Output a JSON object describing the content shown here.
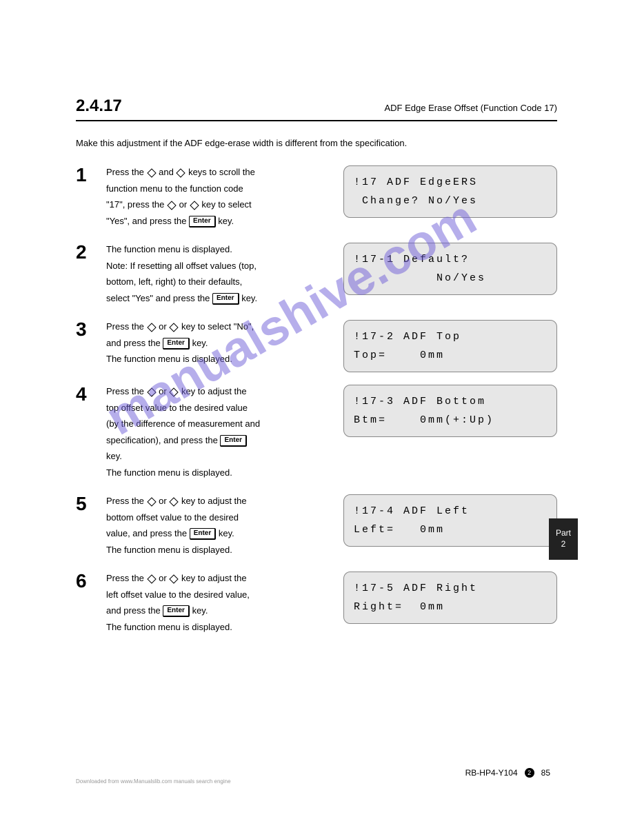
{
  "header": {
    "title": "2.4.17",
    "subtitle": "ADF Edge Erase Offset  (Function Code 17)"
  },
  "intro": "Make this adjustment if the ADF edge-erase width is different from the specification.",
  "watermark": "manualshive.com",
  "sidetab_line1": "Part",
  "sidetab_line2": "2",
  "steps": [
    {
      "num": "1",
      "text_lines": [
        "Press the <d> and <d> keys to scroll the",
        "function menu to the function code",
        "\"17\", press the <d> or <d> key to select",
        "\"Yes\", and press the <k>Enter</k> key."
      ],
      "lcd_lines": [
        "!17 ADF EdgeERS",
        " Change? No/Yes"
      ]
    },
    {
      "num": "2",
      "text_lines": [
        "The function menu is displayed.",
        "Note: If resetting all offset values (top,",
        "bottom, left, right) to their defaults,",
        "select \"Yes\" and press the <k>Enter</k> key."
      ],
      "lcd_lines": [
        "!17-1 Default?",
        "          No/Yes"
      ]
    },
    {
      "num": "3",
      "text_lines": [
        "Press the <d> or <d> key to select \"No\",",
        "and press the <k>Enter</k> key.",
        "The function menu is displayed."
      ],
      "lcd_lines": [
        "!17-2 ADF Top",
        "Top=    0mm"
      ]
    },
    {
      "num": "4",
      "text_lines": [
        "Press the <d> or <d> key to adjust the",
        "top offset value to the desired value",
        "(by the difference of measurement and",
        "specification), and press the <k>Enter</k>",
        "key.",
        "The function menu is displayed."
      ],
      "lcd_lines": [
        "!17-3 ADF Bottom",
        "Btm=    0mm(+:Up)"
      ]
    },
    {
      "num": "5",
      "text_lines": [
        "Press the <d> or <d> key to adjust the",
        "bottom offset value to the desired",
        "value, and press the <k>Enter</k> key.",
        "The function menu is displayed."
      ],
      "lcd_lines": [
        "!17-4 ADF Left",
        "Left=   0mm"
      ]
    },
    {
      "num": "6",
      "text_lines": [
        "Press the <d> or <d> key to adjust the",
        "left offset value to the desired value,",
        "and press the <k>Enter</k> key.",
        "The function menu is displayed."
      ],
      "lcd_lines": [
        "!17-5 ADF Right",
        "Right=  0mm"
      ]
    }
  ],
  "footer": {
    "text": "RB-HP4-Y104",
    "page_section": "2",
    "page_num": "85"
  },
  "fine_print": "Downloaded from www.Manualslib.com manuals search engine"
}
